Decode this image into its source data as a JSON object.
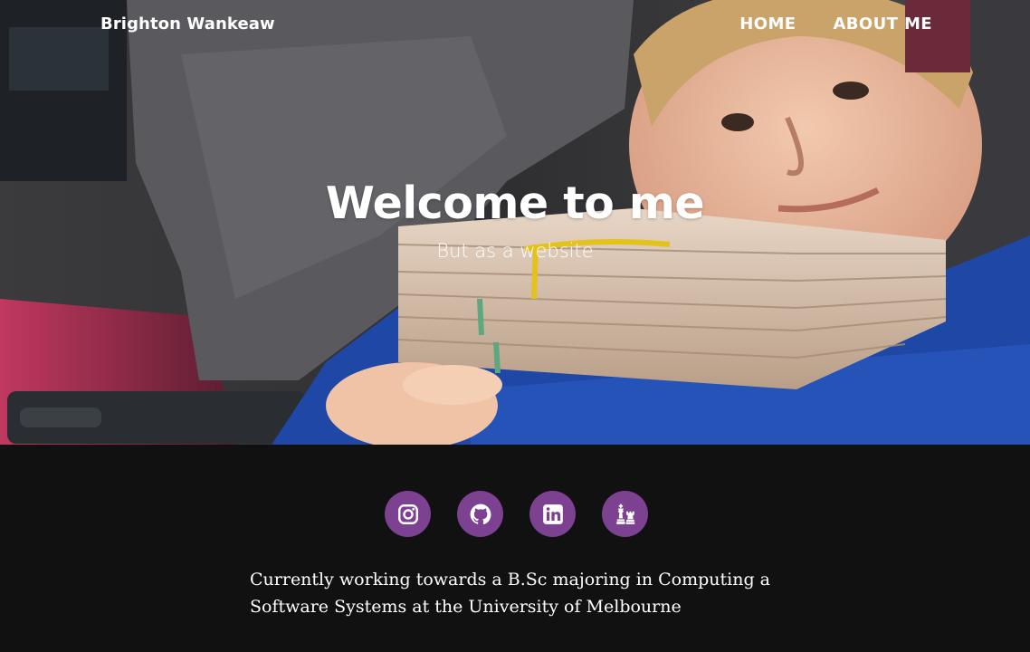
{
  "nav": {
    "brand": "Brighton Wankeaw",
    "links": [
      "HOME",
      "ABOUT ME"
    ]
  },
  "hero": {
    "title": "Welcome to me",
    "subtitle": "But as a website"
  },
  "social": {
    "icons": [
      "instagram-icon",
      "github-icon",
      "linkedin-icon",
      "chess-icon"
    ],
    "accent": "#7d4191"
  },
  "bio": "Currently working towards a B.Sc majoring in Computing a Software Systems at the University of Melbourne",
  "colors": {
    "background": "#121112",
    "text": "#ffffff"
  }
}
